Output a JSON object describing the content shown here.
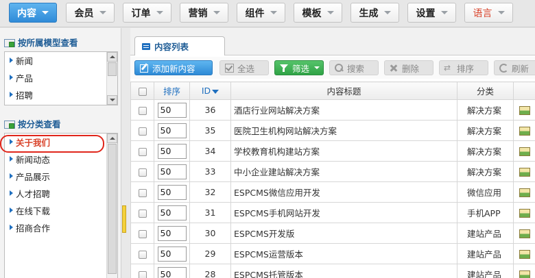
{
  "nav": {
    "items": [
      {
        "label": "内容",
        "active": true
      },
      {
        "label": "会员"
      },
      {
        "label": "订单"
      },
      {
        "label": "营销"
      },
      {
        "label": "组件"
      },
      {
        "label": "模板"
      },
      {
        "label": "生成"
      },
      {
        "label": "设置"
      },
      {
        "label": "语言",
        "color": "#d9432a"
      }
    ]
  },
  "sidebar": {
    "model_section": {
      "title": "按所属模型查看",
      "items": [
        "新闻",
        "产品",
        "招聘"
      ]
    },
    "category_section": {
      "title": "按分类查看",
      "items": [
        "关于我们",
        "新闻动态",
        "产品展示",
        "人才招聘",
        "在线下载",
        "招商合作"
      ]
    }
  },
  "tab": {
    "label": "内容列表"
  },
  "toolbar": {
    "add": "添加新内容",
    "select_all": "全选",
    "filter": "筛选",
    "search": "搜索",
    "delete": "删除",
    "sort": "排序",
    "refresh": "刷新"
  },
  "table": {
    "headers": {
      "sort": "排序",
      "id": "ID",
      "title": "内容标题",
      "category": "分类"
    },
    "rows": [
      {
        "sort": "50",
        "id": "36",
        "title": "酒店行业网站解决方案",
        "category": "解决方案"
      },
      {
        "sort": "50",
        "id": "35",
        "title": "医院卫生机构网站解决方案",
        "category": "解决方案"
      },
      {
        "sort": "50",
        "id": "34",
        "title": "学校教育机构建站方案",
        "category": "解决方案"
      },
      {
        "sort": "50",
        "id": "33",
        "title": "中小企业建站解决方案",
        "category": "解决方案"
      },
      {
        "sort": "50",
        "id": "32",
        "title": "ESPCMS微信应用开发",
        "category": "微信应用"
      },
      {
        "sort": "50",
        "id": "31",
        "title": "ESPCMS手机网站开发",
        "category": "手机APP"
      },
      {
        "sort": "50",
        "id": "30",
        "title": "ESPCMS开发版",
        "category": "建站产品"
      },
      {
        "sort": "50",
        "id": "29",
        "title": "ESPCMS运营版本",
        "category": "建站产品"
      },
      {
        "sort": "50",
        "id": "28",
        "title": "ESPCMS托管版本",
        "category": "建站产品"
      }
    ]
  },
  "colors": {
    "accent": "#2f8bd8",
    "highlight": "#d9432a",
    "link": "#1f6fbf"
  }
}
